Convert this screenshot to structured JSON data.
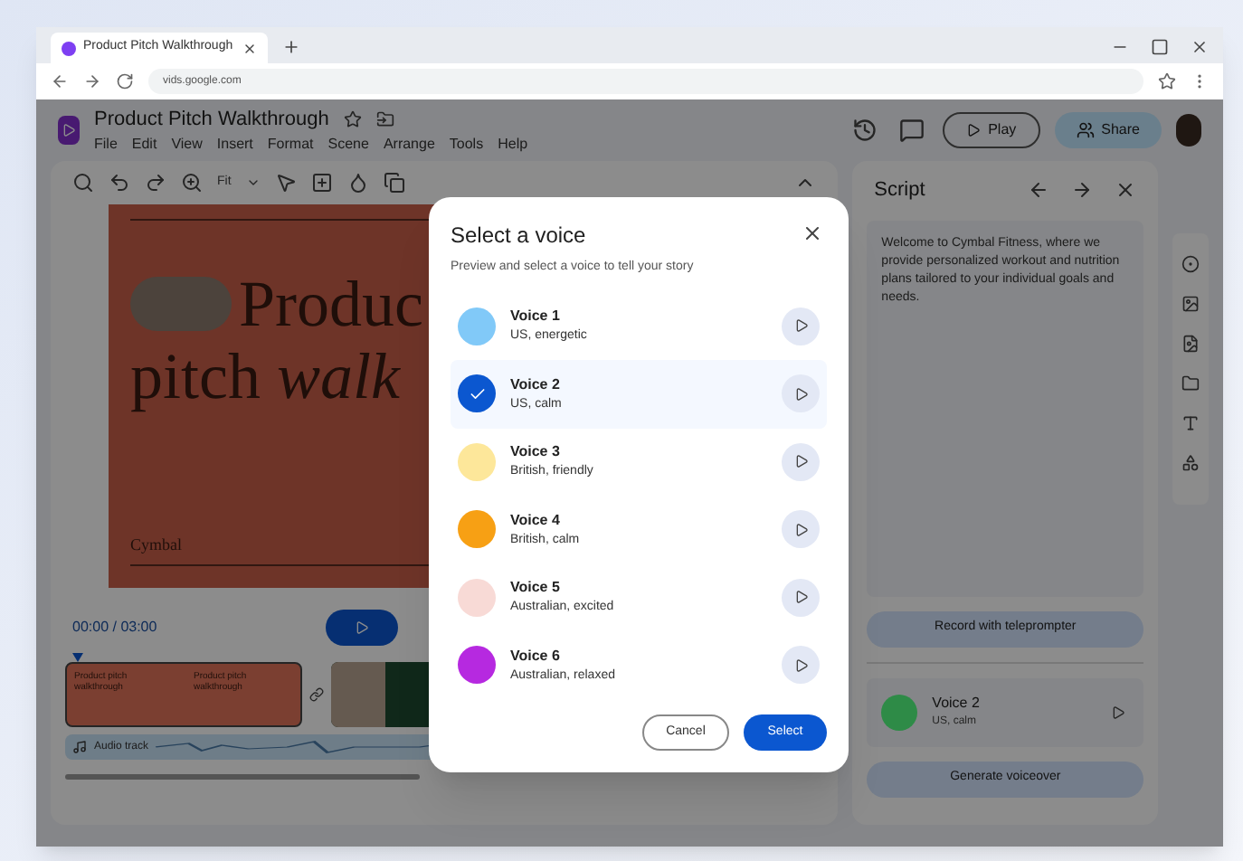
{
  "browser": {
    "tab_title": "Product Pitch Walkthrough",
    "url": "vids.google.com"
  },
  "app": {
    "title": "Product Pitch Walkthrough",
    "menu": [
      "File",
      "Edit",
      "View",
      "Insert",
      "Format",
      "Scene",
      "Arrange",
      "Tools",
      "Help"
    ],
    "play": "Play",
    "share": "Share"
  },
  "toolbar": {
    "zoom": "Fit"
  },
  "slide": {
    "line1": "Produc",
    "line2": "pitch *walk*",
    "footer": "Cymbal"
  },
  "timeline": {
    "time": "00:00 / 03:00",
    "clips": [
      "Product pitch walkthrough",
      "Product pitch walkthrough"
    ],
    "audio_label": "Audio track"
  },
  "script": {
    "title": "Script",
    "text": "Welcome to Cymbal Fitness, where we provide personalized workout and nutrition plans tailored to your individual goals and needs.",
    "record": "Record with teleprompter",
    "voice": {
      "name": "Voice 2",
      "desc": "US, calm",
      "color": "#2e8b47"
    },
    "generate": "Generate voiceover"
  },
  "dialog": {
    "title": "Select a voice",
    "subtitle": "Preview and select a voice to tell your story",
    "voices": [
      {
        "name": "Voice 1",
        "desc": "US, energetic",
        "color": "#81c9f8",
        "selected": false
      },
      {
        "name": "Voice 2",
        "desc": "US, calm",
        "color": "#0b57d0",
        "selected": true
      },
      {
        "name": "Voice 3",
        "desc": "British, friendly",
        "color": "#fde79a",
        "selected": false
      },
      {
        "name": "Voice 4",
        "desc": "British, calm",
        "color": "#f7a014",
        "selected": false
      },
      {
        "name": "Voice 5",
        "desc": "Australian, excited",
        "color": "#f8dad6",
        "selected": false
      },
      {
        "name": "Voice 6",
        "desc": "Australian, relaxed",
        "color": "#b629e0",
        "selected": false
      }
    ],
    "cancel": "Cancel",
    "select": "Select"
  }
}
